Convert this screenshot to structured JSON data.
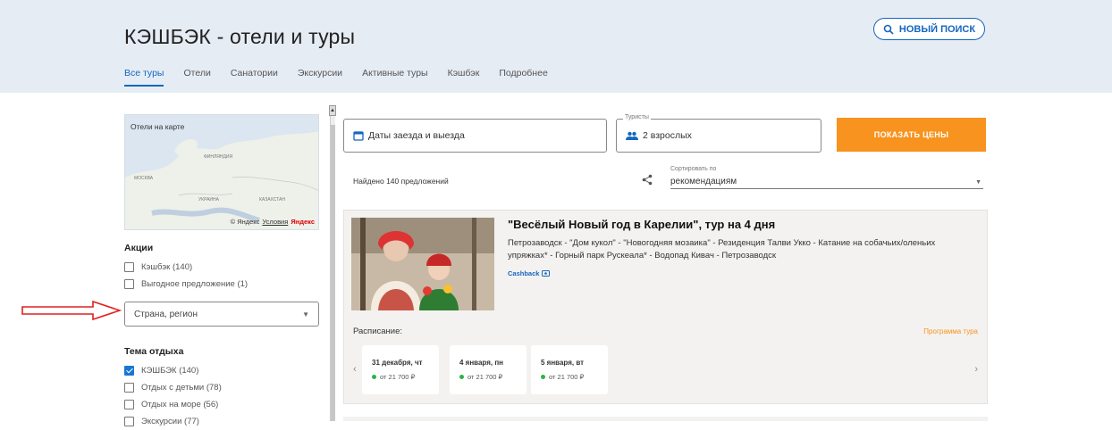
{
  "header": {
    "title": "КЭШБЭК - отели и туры",
    "new_search_label": "новый поиск",
    "tabs": [
      {
        "label": "Все туры",
        "active": true
      },
      {
        "label": "Отели"
      },
      {
        "label": "Санатории"
      },
      {
        "label": "Экскурсии"
      },
      {
        "label": "Активные туры"
      },
      {
        "label": "Кэшбэк"
      },
      {
        "label": "Подробнее"
      }
    ]
  },
  "sidebar": {
    "map": {
      "title": "Отели на карте",
      "footer_copyright": "© Яндекс",
      "footer_terms": "Условия",
      "footer_logo": "Яндекс",
      "labels": [
        "ФИНЛЯНДИЯ",
        "МОСКВА",
        "УКРАИНА",
        "КАЗАХСТАН"
      ]
    },
    "promos_title": "Акции",
    "promos": [
      {
        "label": "Кэшбэк (140)",
        "checked": false
      },
      {
        "label": "Выгодное предложение (1)",
        "checked": false
      }
    ],
    "region_placeholder": "Страна, регион",
    "theme_title": "Тема отдыха",
    "themes": [
      {
        "label": "КЭШБЭК (140)",
        "checked": true
      },
      {
        "label": "Отдых с детьми (78)",
        "checked": false
      },
      {
        "label": "Отдых на море (56)",
        "checked": false
      },
      {
        "label": "Экскурсии (77)",
        "checked": false
      }
    ]
  },
  "search": {
    "dates_placeholder": "Даты заезда и выезда",
    "tourists_legend": "Туристы",
    "tourists_value": "2 взрослых",
    "show_prices_label": "Показать цены",
    "found_text": "Найдено 140 предложений",
    "sort_label": "Сортировать по",
    "sort_value": "рекомендациям"
  },
  "tour": {
    "title": "\"Весёлый Новый год в Карелии\", тур на 4 дня",
    "description": "Петрозаводск - \"Дом кукол\" - \"Новогодняя мозаика\" - Резиденция Талви Укко - Катание на собачьих/оленьих упряжках* - Горный парк Рускеала* - Водопад Кивач - Петрозаводск",
    "cashback_label": "Cashback",
    "schedule_label": "Расписание:",
    "program_label": "Программа тура",
    "dates": [
      {
        "date": "31 декабря, чт",
        "price": "от 21 700 ₽"
      },
      {
        "date": "4 января, пн",
        "price": "от 21 700 ₽"
      },
      {
        "date": "5 января, вт",
        "price": "от 21 700 ₽"
      }
    ]
  },
  "colors": {
    "accent": "#1565c0",
    "button": "#f7931e",
    "header_bg": "#e6ecf4",
    "available_dot": "#2eb24a",
    "annotation_arrow": "#e02020"
  }
}
